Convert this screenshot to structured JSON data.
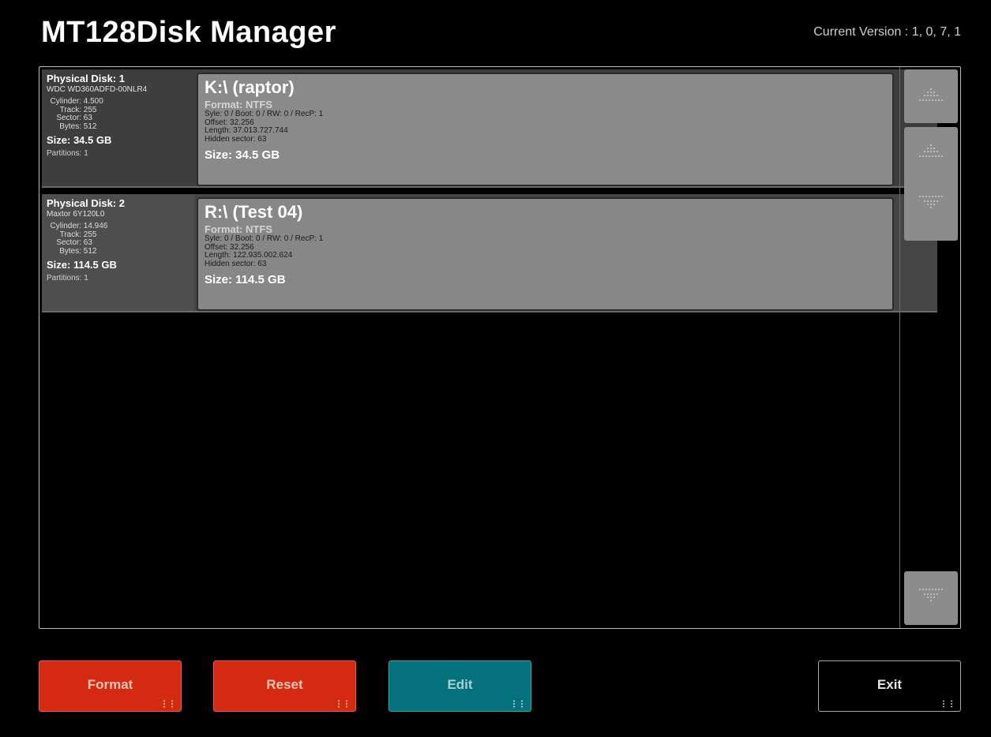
{
  "header": {
    "title": "MT128Disk Manager",
    "version": "Current Version : 1, 0, 7, 1"
  },
  "disks": [
    {
      "heading": "Physical Disk: 1",
      "model": "WDC WD360ADFD-00NLR4",
      "cylinder_label": "Cylinder:",
      "cylinder": "4.500",
      "track_label": "Track:",
      "track": "255",
      "sector_label": "Sector:",
      "sector": "63",
      "bytes_label": "Bytes:",
      "bytes": "512",
      "size": "Size: 34.5 GB",
      "partitions": "Partitions: 1",
      "partition": {
        "name": "K:\\ (raptor)",
        "format": "Format: NTFS",
        "flags": "Syle: 0 / Boot: 0 / RW: 0 / RecP: 1",
        "offset": "Offset:  32.256",
        "length": "Length:  37.013.727.744",
        "hidden": "Hidden sector: 63",
        "size": "Size: 34.5 GB"
      }
    },
    {
      "heading": "Physical Disk: 2",
      "model": "Maxtor 6Y120L0",
      "cylinder_label": "Cylinder:",
      "cylinder": "14.946",
      "track_label": "Track:",
      "track": "255",
      "sector_label": "Sector:",
      "sector": "63",
      "bytes_label": "Bytes:",
      "bytes": "512",
      "size": "Size: 114.5 GB",
      "partitions": "Partitions: 1",
      "partition": {
        "name": "R:\\ (Test 04)",
        "format": "Format: NTFS",
        "flags": "Syle: 0 / Boot: 0 / RW: 0 / RecP: 1",
        "offset": "Offset:  32.256",
        "length": "Length:  122.935.002.624",
        "hidden": "Hidden sector: 63",
        "size": "Size: 114.5 GB"
      }
    }
  ],
  "scroll": {
    "top_icon": "double-up-arrow-icon",
    "up_icon": "up-arrow-icon",
    "down_icon": "down-arrow-icon",
    "bottom_icon": "double-down-arrow-icon"
  },
  "buttons": {
    "format": "Format",
    "reset": "Reset",
    "edit": "Edit",
    "exit": "Exit"
  },
  "colors": {
    "format_btn": "#d42a12",
    "reset_btn": "#d42a12",
    "edit_btn": "#05717c",
    "exit_btn": "#000000"
  }
}
